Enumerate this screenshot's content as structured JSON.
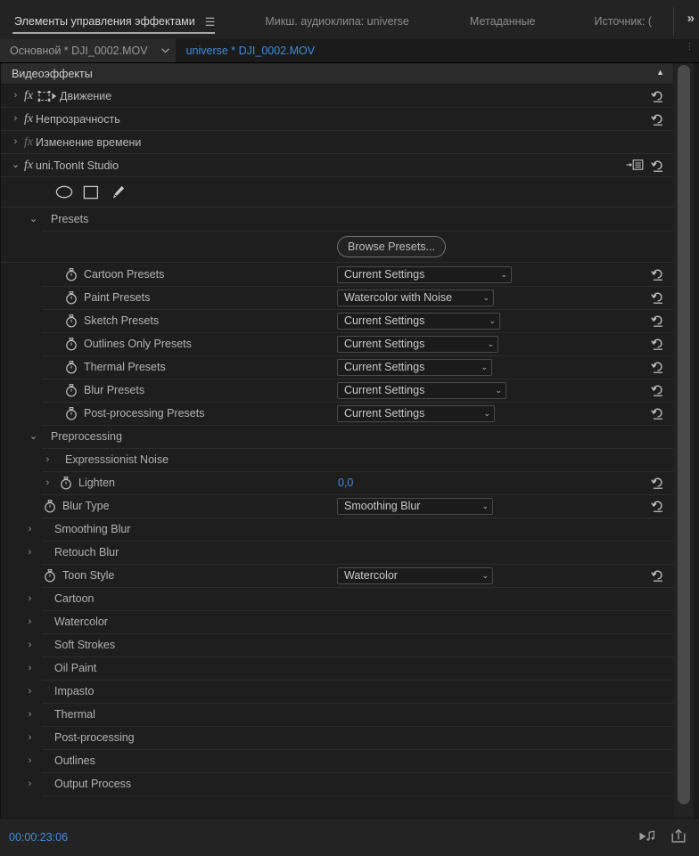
{
  "panel_tabs": [
    {
      "label": "Элементы управления эффектами",
      "active": true,
      "has_menu": true
    },
    {
      "label": "Микш. аудиоклипа: universe",
      "active": false,
      "has_menu": false
    },
    {
      "label": "Метаданные",
      "active": false,
      "has_menu": false
    },
    {
      "label": "Источник: (",
      "active": false,
      "has_menu": false
    }
  ],
  "tabbar": {
    "overflow_label": "»",
    "menu_glyph": "☰"
  },
  "clipbar": {
    "sequence_label": "Основной * DJI_0002.MOV",
    "clip_label": "universe * DJI_0002.MOV"
  },
  "section_header": {
    "title": "Видеоэффекты",
    "collapse_glyph": "▲"
  },
  "effects": [
    {
      "name": "Движение",
      "fx": "fx",
      "dim": false,
      "icon": "motion-icon"
    },
    {
      "name": "Непрозрачность",
      "fx": "fx",
      "dim": false
    },
    {
      "name": "Изменение времени",
      "fx": "fx",
      "dim": true
    },
    {
      "name": "uni.ToonIt Studio",
      "fx": "fx",
      "dim": false
    }
  ],
  "mask_tools": [
    {
      "name": "ellipse-mask-tool"
    },
    {
      "name": "rectangle-mask-tool"
    },
    {
      "name": "pen-mask-tool"
    }
  ],
  "groups": {
    "presets": "Presets",
    "preprocessing": "Preprocessing",
    "expressionist_noise": "Expresssionist Noise",
    "smoothing_blur": "Smoothing Blur",
    "retouch_blur": "Retouch Blur",
    "cartoon": "Cartoon",
    "watercolor": "Watercolor",
    "soft_strokes": "Soft Strokes",
    "oil_paint": "Oil Paint",
    "impasto": "Impasto",
    "thermal": "Thermal",
    "post_processing": "Post-processing",
    "outlines": "Outlines",
    "output_process": "Output Process"
  },
  "browse_presets_label": "Browse Presets...",
  "preset_params": [
    {
      "label": "Cartoon Presets",
      "value": "Current Settings",
      "dd_width": 196
    },
    {
      "label": "Paint Presets",
      "value": "Watercolor with Noise",
      "dd_width": 176
    },
    {
      "label": "Sketch Presets",
      "value": "Current Settings",
      "dd_width": 183
    },
    {
      "label": "Outlines Only Presets",
      "value": "Current Settings",
      "dd_width": 181
    },
    {
      "label": "Thermal Presets",
      "value": "Current Settings",
      "dd_width": 174
    },
    {
      "label": "Blur Presets",
      "value": "Current Settings",
      "dd_width": 190
    },
    {
      "label": "Post-processing Presets",
      "value": "Current Settings",
      "dd_width": 177
    }
  ],
  "lighten": {
    "label": "Lighten",
    "value": "0,0"
  },
  "blur_type": {
    "label": "Blur Type",
    "value": "Smoothing Blur",
    "dd_width": 175
  },
  "toon_style": {
    "label": "Toon Style",
    "value": "Watercolor",
    "dd_width": 175
  },
  "statusbar": {
    "timecode": "00:00:23:06",
    "icons": [
      {
        "name": "play-audio-icon"
      },
      {
        "name": "export-frame-icon"
      }
    ]
  },
  "colors": {
    "accent_blue": "#3f8de0",
    "panel_bg": "#1e1e1e",
    "tabbar_bg": "#232323",
    "row_separator": "#2c2c2c"
  }
}
